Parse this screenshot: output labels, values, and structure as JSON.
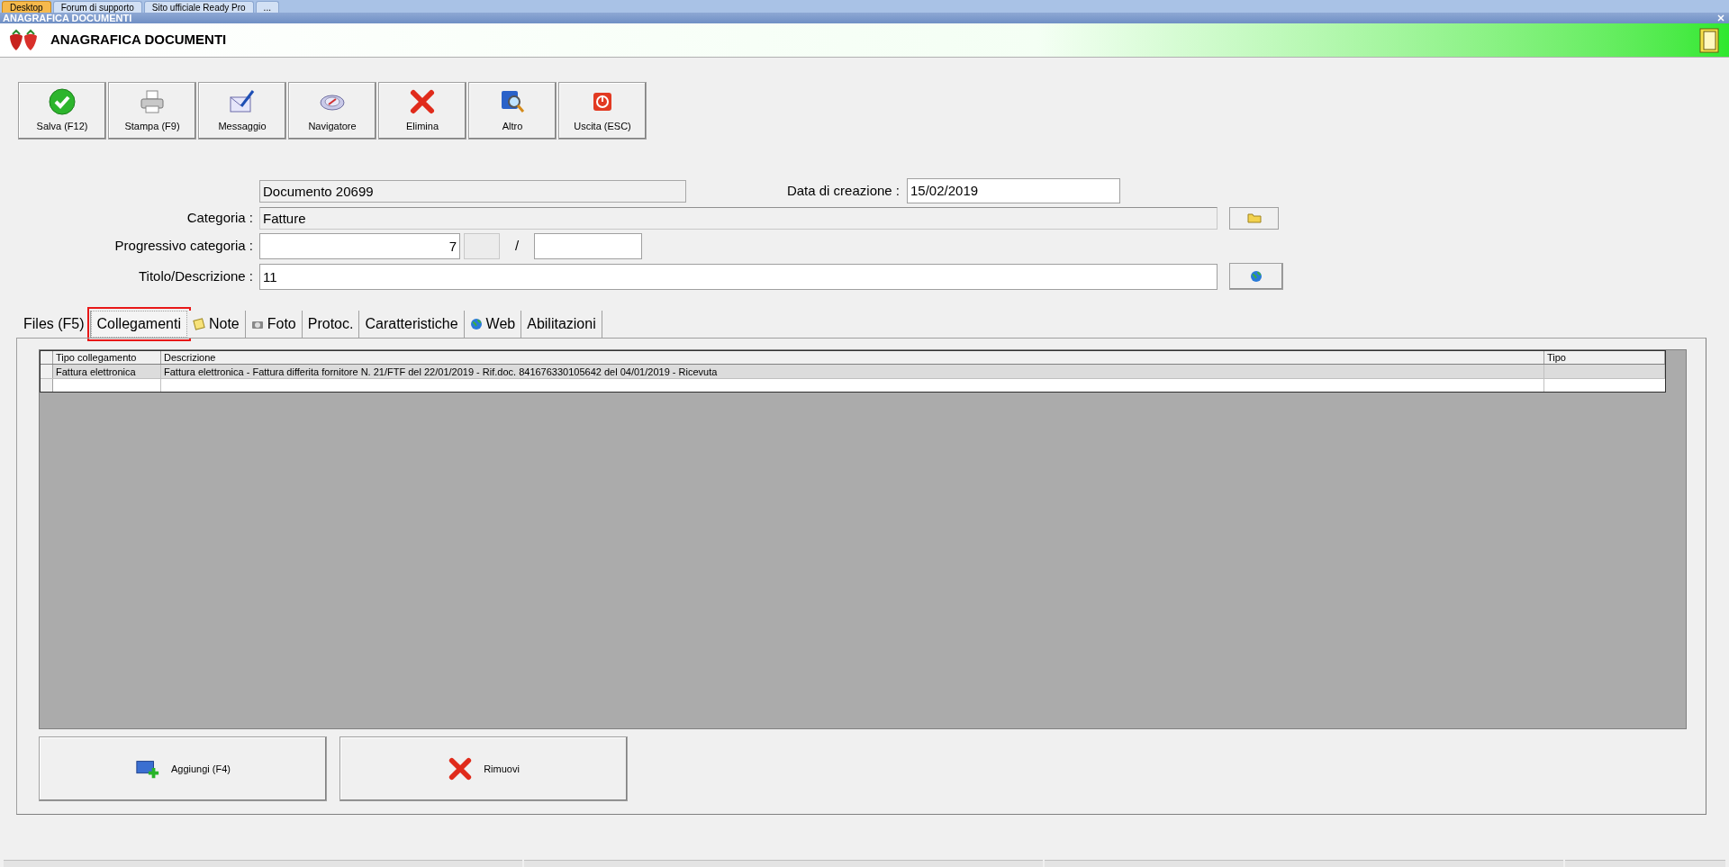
{
  "taskbar_tabs": [
    {
      "label": "Desktop",
      "selected": true
    },
    {
      "label": "Forum di supporto",
      "selected": false
    },
    {
      "label": "Sito ufficiale Ready Pro",
      "selected": false
    },
    {
      "label": "...",
      "selected": false
    }
  ],
  "window": {
    "title": "ANAGRAFICA DOCUMENTI"
  },
  "header": {
    "title": "ANAGRAFICA DOCUMENTI"
  },
  "toolbar": [
    {
      "label": "Salva (F12)",
      "kind": "check"
    },
    {
      "label": "Stampa (F9)",
      "kind": "printer"
    },
    {
      "label": "Messaggio",
      "kind": "mail"
    },
    {
      "label": "Navigatore",
      "kind": "compass"
    },
    {
      "label": "Elimina",
      "kind": "cross"
    },
    {
      "label": "Altro",
      "kind": "search"
    },
    {
      "label": "Uscita (ESC)",
      "kind": "power"
    }
  ],
  "form": {
    "document": "Documento 20699",
    "creation_date_label": "Data di creazione :",
    "creation_date": "15/02/2019",
    "category_label": "Categoria :",
    "category": "Fatture",
    "progressive_label": "Progressivo categoria :",
    "progressive": "7",
    "separator": "/",
    "title_label": "Titolo/Descrizione :",
    "title": "11"
  },
  "tabs": [
    {
      "label": "Files (F5)",
      "selected": false,
      "kind": "plain"
    },
    {
      "label": "Collegamenti",
      "selected": true,
      "kind": "plain"
    },
    {
      "label": "Note",
      "selected": false,
      "kind": "note"
    },
    {
      "label": "Foto",
      "selected": false,
      "kind": "camera"
    },
    {
      "label": "Protoc.",
      "selected": false,
      "kind": "plain"
    },
    {
      "label": "Caratteristiche",
      "selected": false,
      "kind": "plain"
    },
    {
      "label": "Web",
      "selected": false,
      "kind": "globe"
    },
    {
      "label": "Abilitazioni",
      "selected": false,
      "kind": "plain"
    }
  ],
  "table": {
    "columns": [
      "Tipo collegamento",
      "Descrizione",
      "Tipo"
    ],
    "rows": [
      [
        "Fattura elettronica",
        "Fattura elettronica - Fattura differita fornitore N. 21/FTF del 22/01/2019 - Rif.doc. 841676330105642 del 04/01/2019 - Ricevuta",
        ""
      ]
    ]
  },
  "buttons": [
    {
      "label": "Aggiungi (F4)",
      "kind": "add"
    },
    {
      "label": "Rimuovi",
      "kind": "cross"
    }
  ]
}
